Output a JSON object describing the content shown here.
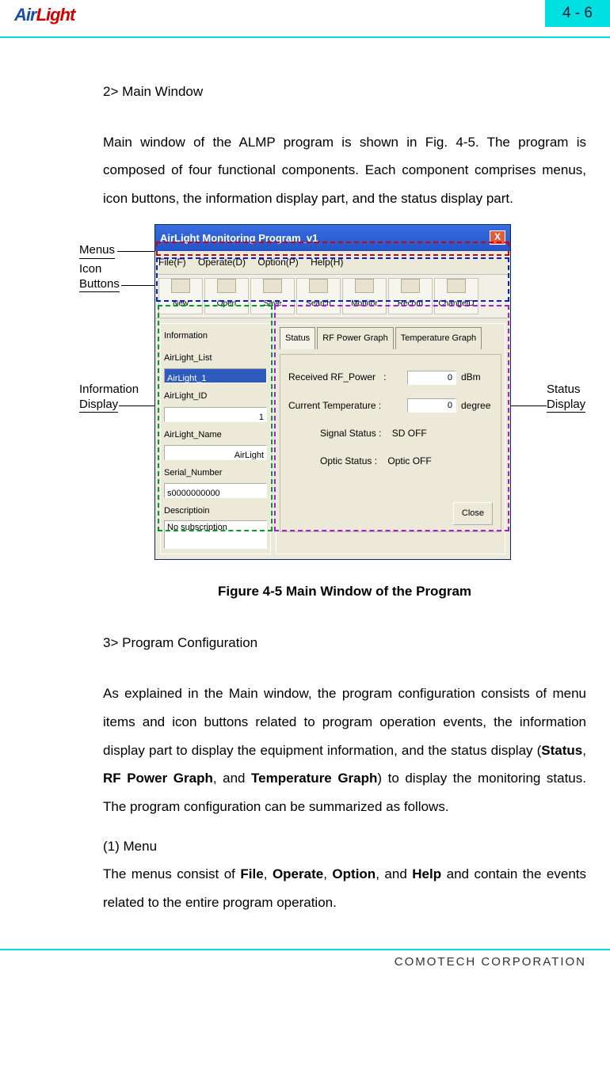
{
  "header": {
    "logo_air": "Air",
    "logo_light": "Light",
    "page_badge": "4 - 6"
  },
  "body": {
    "sec2_title": "2> Main Window",
    "sec2_para": "Main window of the ALMP program is shown in Fig. 4-5. The program is composed of four functional components. Each component comprises menus, icon buttons, the information display part, and the status display part.",
    "fig_caption": "Figure 4-5 Main Window of the Program",
    "sec3_title": "3> Program Configuration",
    "sec3_para_a": "As explained in the Main window, the program configuration consists of menu items and icon buttons related to program operation events, the information display part to display the equipment information, and the status display (",
    "sec3_bold_status": "Status",
    "sec3_sep1": ", ",
    "sec3_bold_rf": "RF Power Graph",
    "sec3_sep2": ", and ",
    "sec3_bold_temp": "Temperature Graph",
    "sec3_para_b": ") to display the monitoring status. The program configuration can be summarized as follows.",
    "sub1_title": "(1) Menu",
    "sub1_para_a": "The menus consist of ",
    "sub1_b_file": "File",
    "sub1_s1": ", ",
    "sub1_b_op": "Operate",
    "sub1_s2": ", ",
    "sub1_b_opt": "Option",
    "sub1_s3": ", and ",
    "sub1_b_help": "Help",
    "sub1_para_b": " and contain the events related to the entire program operation."
  },
  "annotations": {
    "menus": "Menus",
    "icon_buttons_l1": "Icon",
    "icon_buttons_l2": "Buttons",
    "info_disp_l1": "Information",
    "info_disp_l2": "Display",
    "status_disp_l1": "Status",
    "status_disp_l2": "Display"
  },
  "app": {
    "title": "AirLight Monitoring Program_v1",
    "close_x": "X",
    "menus": {
      "file": "File(F)",
      "operate": "Operate(D)",
      "option": "Option(P)",
      "help": "Help(H)"
    },
    "toolbar": {
      "new": "New",
      "open": "Open",
      "save": "Save",
      "search": "Search",
      "monitor": "Monitor",
      "record": "Record",
      "changeid": "ChangeID"
    },
    "info": {
      "group": "Information",
      "list_label": "AirLight_List",
      "list_value": "AirLight_1",
      "id_label": "AirLight_ID",
      "id_value": "1",
      "name_label": "AirLight_Name",
      "name_value": "AirLight",
      "serial_label": "Serial_Number",
      "serial_value": "s0000000000",
      "desc_label": "Descriptioin",
      "desc_value": "No subscription"
    },
    "status": {
      "tab_status": "Status",
      "tab_rf": "RF Power Graph",
      "tab_temp": "Temperature Graph",
      "rf_label": "Received RF_Power",
      "rf_value": "0",
      "rf_unit": "dBm",
      "temp_label": "Current Temperature :",
      "temp_value": "0",
      "temp_unit": "degree",
      "sig_label": "Signal Status :",
      "sig_value": "SD OFF",
      "opt_label": "Optic Status :",
      "opt_value": "Optic OFF",
      "close_btn": "Close",
      "colon": ":"
    }
  },
  "footer": {
    "text": "COMOTECH CORPORATION"
  }
}
